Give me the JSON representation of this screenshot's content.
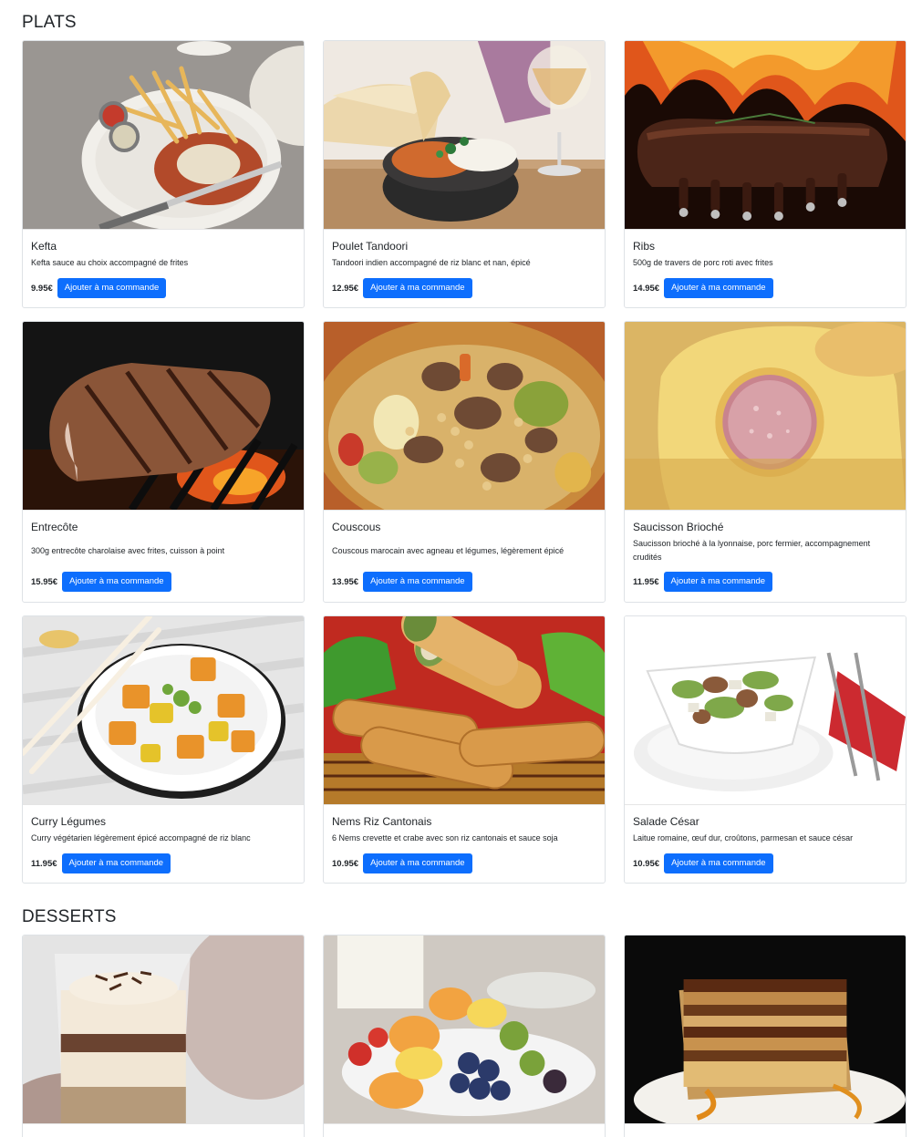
{
  "sections": [
    {
      "title": "PLATS",
      "items": [
        {
          "name": "Kefta",
          "description": "Kefta sauce au choix accompagné de frites",
          "price": "9.95€",
          "button": "Ajouter à ma commande"
        },
        {
          "name": "Poulet Tandoori",
          "description": "Tandoori indien accompagné de riz blanc et nan, épicé",
          "price": "12.95€",
          "button": "Ajouter à ma commande"
        },
        {
          "name": "Ribs",
          "description": "500g de travers de porc roti avec frites",
          "price": "14.95€",
          "button": "Ajouter à ma commande"
        },
        {
          "name": "Entrecôte",
          "description": "300g entrecôte charolaise avec frites, cuisson à point",
          "price": "15.95€",
          "button": "Ajouter à ma commande"
        },
        {
          "name": "Couscous",
          "description": "Couscous marocain avec agneau et légumes, légèrement épicé",
          "price": "13.95€",
          "button": "Ajouter à ma commande"
        },
        {
          "name": "Saucisson Brioché",
          "description": "Saucisson brioché à la lyonnaise, porc fermier, accompagnement crudités",
          "price": "11.95€",
          "button": "Ajouter à ma commande"
        },
        {
          "name": "Curry Légumes",
          "description": "Curry végétarien légèrement épicé accompagné de riz blanc",
          "price": "11.95€",
          "button": "Ajouter à ma commande"
        },
        {
          "name": "Nems Riz Cantonais",
          "description": "6 Nems crevette et crabe avec son riz cantonais et sauce soja",
          "price": "10.95€",
          "button": "Ajouter à ma commande"
        },
        {
          "name": "Salade César",
          "description": "Laitue romaine, œuf dur, croûtons, parmesan et sauce césar",
          "price": "10.95€",
          "button": "Ajouter à ma commande"
        }
      ]
    },
    {
      "title": "DESSERTS",
      "items": []
    }
  ],
  "colors": {
    "accent": "#0d6efd",
    "card_border": "#dee2e6",
    "text": "#212529"
  }
}
